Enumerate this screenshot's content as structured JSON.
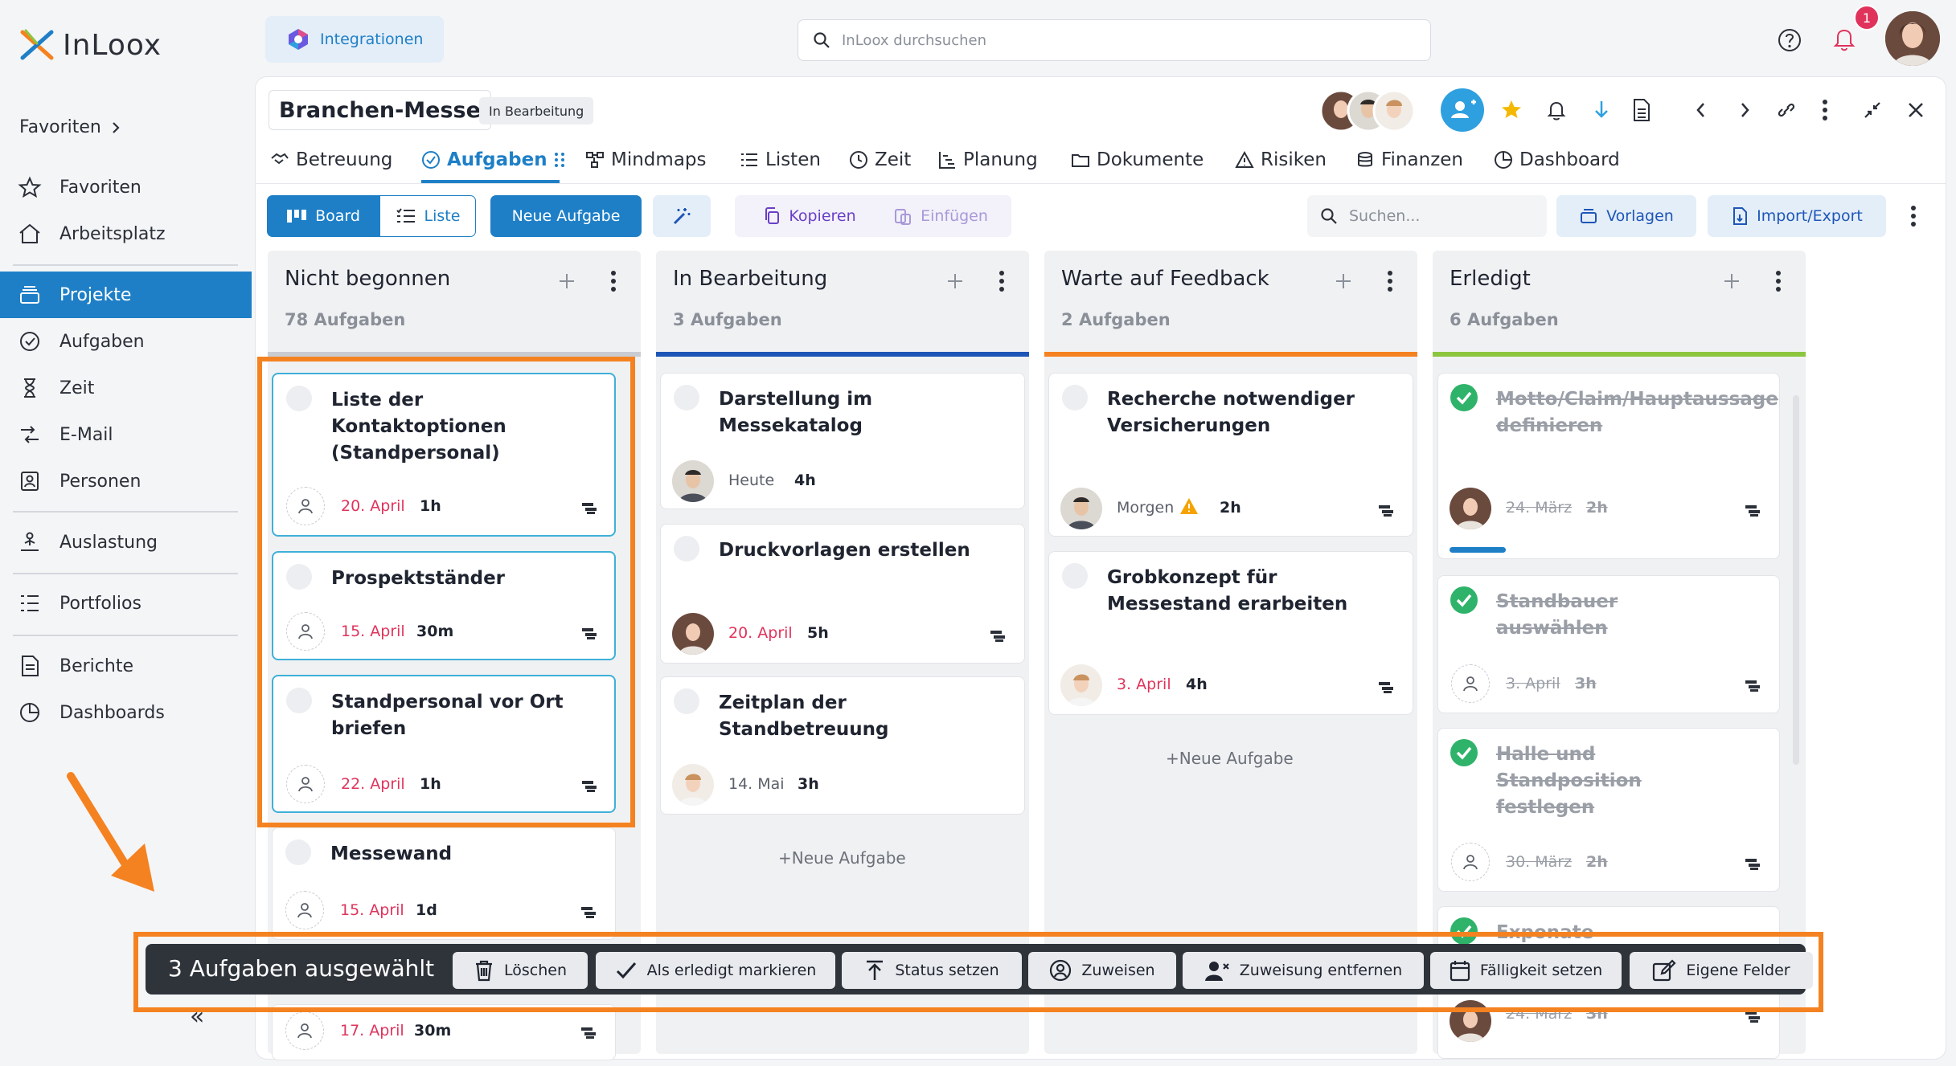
{
  "app": {
    "logo_text": "InLoox"
  },
  "sidebar": {
    "favorites_header": "Favoriten",
    "items": [
      {
        "label": "Favoriten",
        "icon": "star-icon"
      },
      {
        "label": "Arbeitsplatz",
        "icon": "home-icon"
      },
      {
        "label": "Projekte",
        "icon": "projects-icon",
        "active": true
      },
      {
        "label": "Aufgaben",
        "icon": "check-circle-icon"
      },
      {
        "label": "Zeit",
        "icon": "hourglass-icon"
      },
      {
        "label": "E-Mail",
        "icon": "email-icon"
      },
      {
        "label": "Personen",
        "icon": "contacts-icon"
      },
      {
        "label": "Auslastung",
        "icon": "workload-icon"
      },
      {
        "label": "Portfolios",
        "icon": "portfolio-icon"
      },
      {
        "label": "Berichte",
        "icon": "report-icon"
      },
      {
        "label": "Dashboards",
        "icon": "dashboard-icon"
      }
    ],
    "collapse_glyph": "«"
  },
  "topbar": {
    "integrations_label": "Integrationen",
    "search_placeholder": "InLoox durchsuchen",
    "notification_count": "1"
  },
  "project": {
    "title": "Branchen-Messe",
    "status": "In Bearbeitung",
    "tabs": [
      {
        "label": "Betreuung",
        "icon": "handshake-icon"
      },
      {
        "label": "Aufgaben",
        "icon": "check-circle-icon",
        "active": true
      },
      {
        "label": "Mindmaps",
        "icon": "mindmap-icon"
      },
      {
        "label": "Listen",
        "icon": "list-icon"
      },
      {
        "label": "Zeit",
        "icon": "clock-icon"
      },
      {
        "label": "Planung",
        "icon": "gantt-icon"
      },
      {
        "label": "Dokumente",
        "icon": "folder-icon"
      },
      {
        "label": "Risiken",
        "icon": "warning-icon"
      },
      {
        "label": "Finanzen",
        "icon": "coins-icon"
      },
      {
        "label": "Dashboard",
        "icon": "dashboard-icon"
      }
    ]
  },
  "toolbar": {
    "board_label": "Board",
    "list_label": "Liste",
    "new_task_label": "Neue Aufgabe",
    "copy_label": "Kopieren",
    "paste_label": "Einfügen",
    "search_placeholder": "Suchen...",
    "templates_label": "Vorlagen",
    "import_export_label": "Import/Export"
  },
  "columns": [
    {
      "title": "Nicht begonnen",
      "count": "78",
      "count_suffix": "Aufgaben",
      "color": "#c9ccd1",
      "cards": [
        {
          "title": "Liste der Kontaktoptionen (Standpersonal)",
          "date": "20. April",
          "duration": "1h",
          "selected": true
        },
        {
          "title": "Prospektständer",
          "date": "15. April",
          "duration": "30m",
          "selected": true
        },
        {
          "title": "Standpersonal vor Ort briefen",
          "date": "22. April",
          "duration": "1h",
          "selected": true
        },
        {
          "title": "Messewand",
          "date": "15. April",
          "duration": "1d"
        },
        {
          "title": "",
          "date": "17. April",
          "duration": "30m"
        }
      ]
    },
    {
      "title": "In Bearbeitung",
      "count": "3",
      "count_suffix": "Aufgaben",
      "color": "#1e56b8",
      "cards": [
        {
          "title": "Darstellung im Messekatalog",
          "date": "Heute",
          "duration": "4h"
        },
        {
          "title": "Druckvorlagen erstellen",
          "date": "20. April",
          "duration": "5h"
        },
        {
          "title": "Zeitplan der Standbetreuung",
          "date": "14. Mai",
          "duration": "3h"
        }
      ],
      "new_task": "Neue Aufgabe"
    },
    {
      "title": "Warte auf Feedback",
      "count": "2",
      "count_suffix": "Aufgaben",
      "color": "#f58220",
      "cards": [
        {
          "title": "Recherche notwendiger Versicherungen",
          "date": "Morgen",
          "duration": "2h"
        },
        {
          "title": "Grobkonzept für Messestand erarbeiten",
          "date": "3. April",
          "duration": "4h"
        }
      ],
      "new_task": "Neue Aufgabe"
    },
    {
      "title": "Erledigt",
      "count": "6",
      "count_suffix": "Aufgaben",
      "color": "#8cc63f",
      "cards": [
        {
          "title": "Motto/Claim/Hauptaussage definieren",
          "date": "24. März",
          "duration": "2h",
          "progress": 0.2
        },
        {
          "title": "Standbauer auswählen",
          "date": "3. April",
          "duration": "3h"
        },
        {
          "title": "Halle und Standposition festlegen",
          "date": "30. März",
          "duration": "2h"
        },
        {
          "title": "Exponate",
          "date": "24. März",
          "duration": "3h"
        }
      ]
    }
  ],
  "bulk_bar": {
    "selection_text": "3 Aufgaben ausgewählt",
    "buttons": [
      {
        "label": "Löschen",
        "icon": "trash-icon"
      },
      {
        "label": "Als erledigt markieren",
        "icon": "checkmark-icon"
      },
      {
        "label": "Status setzen",
        "icon": "status-icon"
      },
      {
        "label": "Zuweisen",
        "icon": "user-circle-icon"
      },
      {
        "label": "Zuweisung entfernen",
        "icon": "user-remove-icon"
      },
      {
        "label": "Fälligkeit setzen",
        "icon": "calendar-icon"
      },
      {
        "label": "Eigene Felder",
        "icon": "edit-fields-icon"
      }
    ]
  },
  "colors": {
    "accent": "#1e7fc7",
    "highlight": "#f58220",
    "overdue": "#e0335b",
    "done": "#2fb36a"
  }
}
